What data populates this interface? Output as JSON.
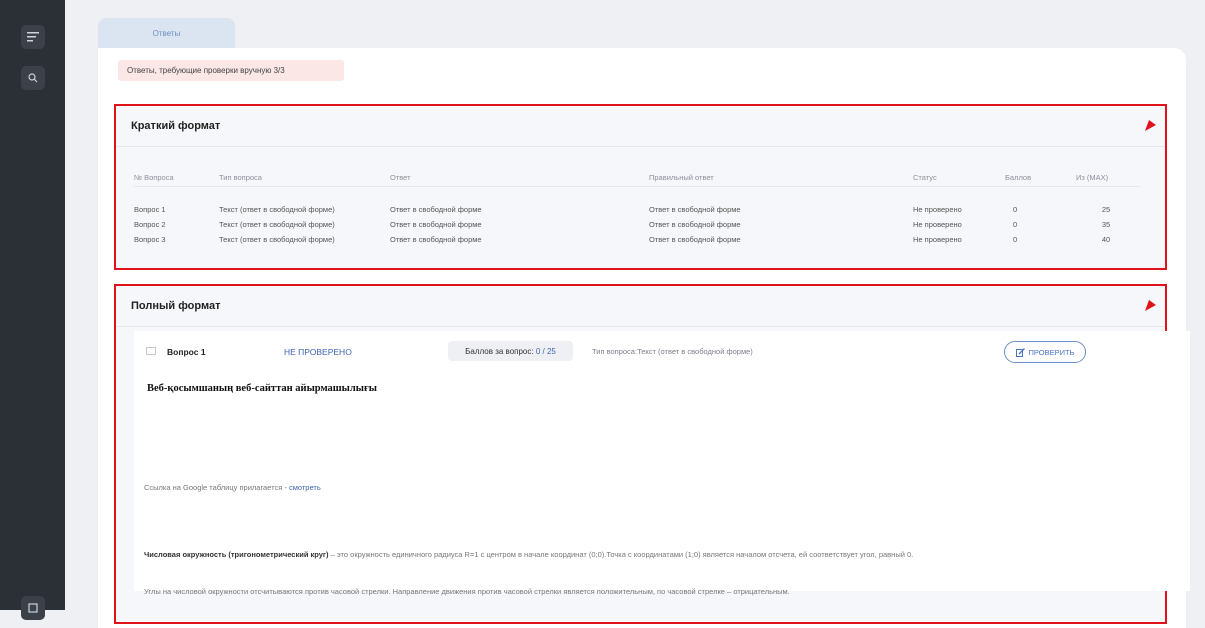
{
  "tab": {
    "label": "Ответы"
  },
  "alert": {
    "text": "Ответы, требующие проверки вручную 3/3"
  },
  "brief": {
    "title": "Краткий формат",
    "columns": [
      "№ Вопроса",
      "Тип вопроса",
      "Ответ",
      "Правильный ответ",
      "Статус",
      "Баллов",
      "Из (MAX)"
    ],
    "rows": [
      {
        "num": "Вопрос 1",
        "type": "Текст (ответ в свободной форме)",
        "answer": "Ответ в свободной форме",
        "correct": "Ответ в свободной форме",
        "status": "Не проверено",
        "score": "0",
        "max": "25"
      },
      {
        "num": "Вопрос 2",
        "type": "Текст (ответ в свободной форме)",
        "answer": "Ответ в свободной форме",
        "correct": "Ответ в свободной форме",
        "status": "Не проверено",
        "score": "0",
        "max": "35"
      },
      {
        "num": "Вопрос 3",
        "type": "Текст (ответ в свободной форме)",
        "answer": "Ответ в свободной форме",
        "correct": "Ответ в свободной форме",
        "status": "Не проверено",
        "score": "0",
        "max": "40"
      }
    ]
  },
  "full": {
    "title": "Полный формат",
    "question": {
      "label": "Вопрос 1",
      "status": "НЕ ПРОВЕРЕНО",
      "score_label": "Баллов за вопрос:",
      "score_value": "0 / 25",
      "type_text": "Тип вопроса:Текст (ответ в свободной форме)",
      "check_button": "ПРОВЕРИТЬ",
      "heading": "Веб-қосымшаның веб-сайттан айырмашылығы",
      "link_prefix": "Ссылка на Google таблицу прилагается - ",
      "link_text": "смотреть",
      "def_bold": "Числовая окружность (тригонометрический круг)",
      "def_rest": " – это окружность единичного радиуса R=1 с центром в начале координат (0;0).Точка с координатами (1;0) является началом отсчета, ей соответствует угол, равный 0.",
      "angles_text": "Углы на числовой окружности отсчитываются против часовой стрелки. Направление движения против часовой стрелки является положительным, по часовой стрелке – отрицательным."
    }
  },
  "icons": [
    "menu-icon",
    "search-icon",
    "flag-icon",
    "edit-icon",
    "checkbox-icon",
    "bottom-nav-icon"
  ],
  "colors": {
    "accent": "#3d64b5",
    "highlight_border": "#e1131a",
    "alert_bg": "#fbe7e6",
    "sidebar": "#2b2f36"
  }
}
